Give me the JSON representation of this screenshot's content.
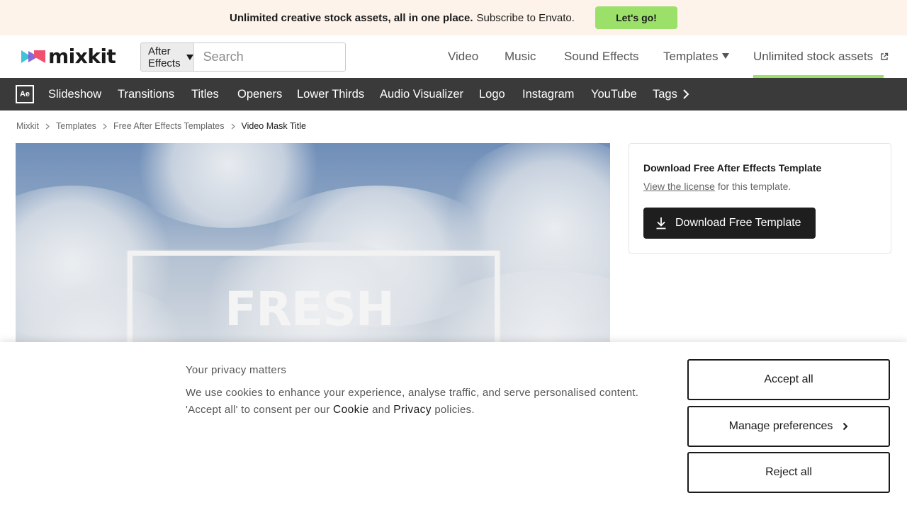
{
  "promo": {
    "bold_text": "Unlimited creative stock assets, all in one place.",
    "rest_text": "Subscribe to Envato.",
    "cta_label": "Let's go!",
    "cta_color": "#9ae069"
  },
  "header": {
    "logo_text": "mixkit",
    "search": {
      "category": "After Effects",
      "placeholder": "Search"
    },
    "nav": [
      {
        "label": "Video"
      },
      {
        "label": "Music"
      },
      {
        "label": "Sound Effects"
      },
      {
        "label": "Templates",
        "has_dropdown": true
      },
      {
        "label": "Unlimited stock assets",
        "external": true,
        "active": true
      }
    ]
  },
  "category_bar": {
    "badge": "Ae",
    "links": [
      "Slideshow",
      "Transitions",
      "Titles",
      "Openers",
      "Lower Thirds",
      "Audio Visualizer",
      "Logo",
      "Instagram",
      "YouTube",
      "Tags"
    ]
  },
  "breadcrumb": [
    "Mixkit",
    "Templates",
    "Free After Effects Templates",
    "Video Mask Title"
  ],
  "preview": {
    "title_text": "FRESH"
  },
  "download_card": {
    "heading": "Download Free After Effects Template",
    "license_link": "View the license",
    "license_suffix": "for this template.",
    "button_label": "Download Free Template"
  },
  "cookie_banner": {
    "title": "Your privacy matters",
    "body_prefix": "We use cookies to enhance your experience, analyse traffic, and serve personalised content. 'Accept all' to consent per our",
    "cookie_link": "Cookie",
    "and_text": "and",
    "privacy_link": "Privacy",
    "body_suffix": "policies.",
    "accept_label": "Accept all",
    "manage_label": "Manage preferences",
    "reject_label": "Reject all"
  }
}
